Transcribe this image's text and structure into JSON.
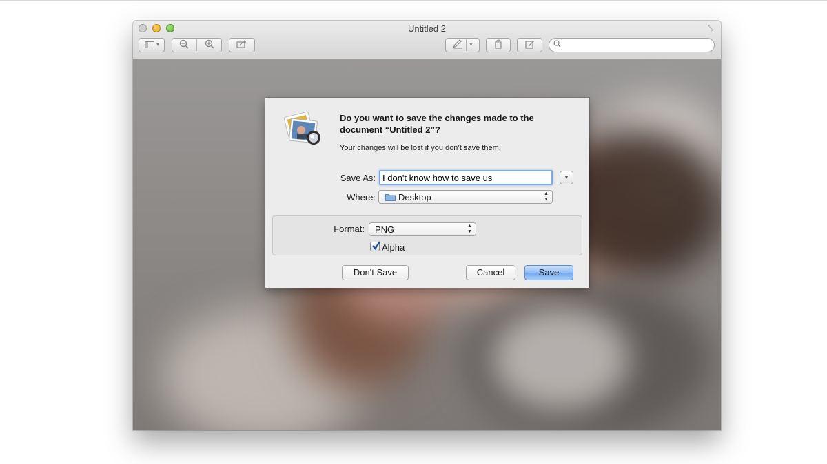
{
  "window": {
    "title": "Untitled 2",
    "toolbar": {
      "sidebar_icon": "sidebar-icon",
      "zoom_out_icon": "zoom-out-icon",
      "zoom_in_icon": "zoom-in-icon",
      "share_icon": "share-icon",
      "markup_icon": "pen-icon",
      "rotate_icon": "rotate-icon",
      "annotate_icon": "annotate-icon",
      "search_placeholder": ""
    }
  },
  "dialog": {
    "title": "Do you want to save the changes made to the document “Untitled 2”?",
    "subtitle": "Your changes will be lost if you don’t save them.",
    "save_as_label": "Save As:",
    "save_as_value": "I don't know how to save us",
    "where_label": "Where:",
    "where_value": "Desktop",
    "format_label": "Format:",
    "format_value": "PNG",
    "alpha_label": "Alpha",
    "alpha_checked": true,
    "buttons": {
      "dont_save": "Don't Save",
      "cancel": "Cancel",
      "save": "Save"
    }
  },
  "colors": {
    "default_button": "#72a8ef",
    "focus_ring": "#7eaadf"
  }
}
